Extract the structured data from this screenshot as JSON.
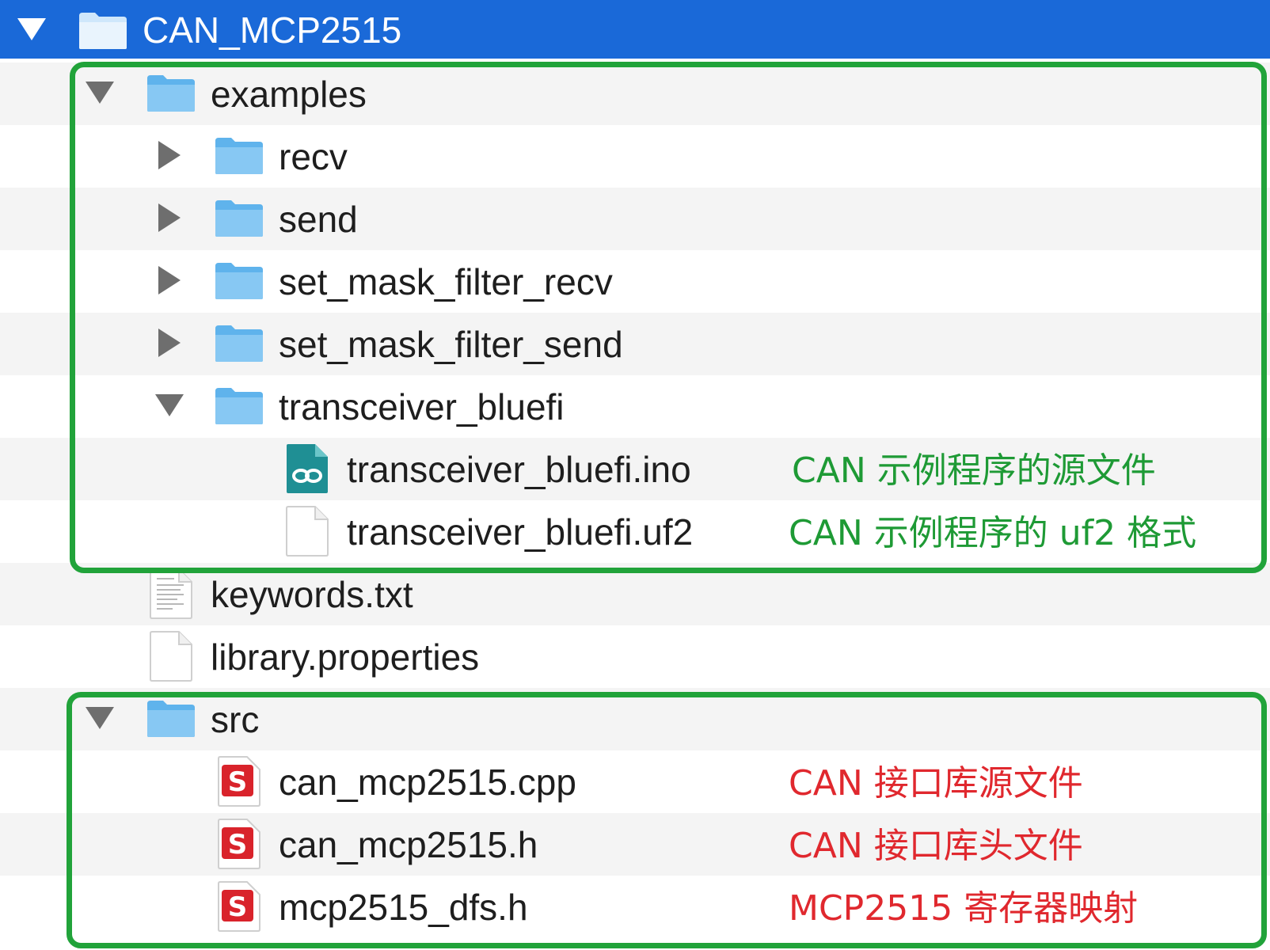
{
  "tree": {
    "root": {
      "name": "CAN_MCP2515"
    },
    "examples": {
      "name": "examples",
      "children": [
        "recv",
        "send",
        "set_mask_filter_recv",
        "set_mask_filter_send"
      ],
      "transceiver": {
        "name": "transceiver_bluefi",
        "ino": "transceiver_bluefi.ino",
        "uf2": "transceiver_bluefi.uf2"
      }
    },
    "keywords": "keywords.txt",
    "library": "library.properties",
    "src": {
      "name": "src",
      "files": [
        "can_mcp2515.cpp",
        "can_mcp2515.h",
        "mcp2515_dfs.h"
      ]
    }
  },
  "annotations": {
    "ino_note": "CAN 示例程序的源文件",
    "uf2_note": "CAN 示例程序的 uf2 格式",
    "cpp_note": "CAN 接口库源文件",
    "h_note": "CAN 接口库头文件",
    "dfs_note": "MCP2515 寄存器映射"
  },
  "colors": {
    "selection": "#1a69d8",
    "highlight_box": "#21a33a",
    "example_note": "#1e9a35",
    "src_note": "#e0282e",
    "folder": "#7cc3f0"
  }
}
